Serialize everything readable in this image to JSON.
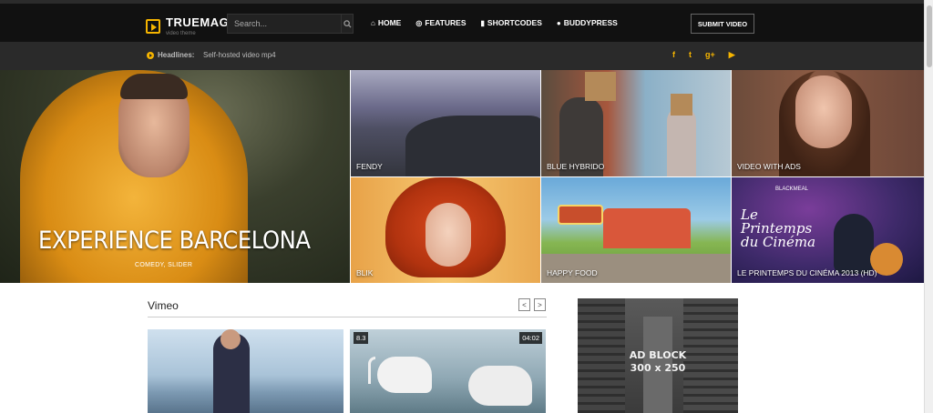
{
  "header": {
    "logo": {
      "name": "TRUEMAG",
      "tagline": "video theme"
    },
    "search": {
      "placeholder": "Search..."
    },
    "nav": [
      {
        "label": "HOME",
        "icon": "home-icon",
        "glyph": "⌂"
      },
      {
        "label": "FEATURES",
        "icon": "target-icon",
        "glyph": "◎"
      },
      {
        "label": "SHORTCODES",
        "icon": "bookmark-icon",
        "glyph": "▮"
      },
      {
        "label": "BUDDYPRESS",
        "icon": "user-icon",
        "glyph": "●"
      }
    ],
    "submit_label": "SUBMIT VIDEO"
  },
  "headlines": {
    "label": "Headlines:",
    "text": "Self-hosted video mp4",
    "social": [
      {
        "icon": "facebook-icon",
        "glyph": "f"
      },
      {
        "icon": "twitter-icon",
        "glyph": "t"
      },
      {
        "icon": "google-plus-icon",
        "glyph": "g+"
      },
      {
        "icon": "youtube-icon",
        "glyph": "▶"
      }
    ]
  },
  "hero": {
    "main": {
      "title": "EXPERIENCE BARCELONA",
      "category": "COMEDY, SLIDER"
    },
    "tiles": [
      {
        "caption": "FENDY"
      },
      {
        "caption": "BLUE HYBRIDO"
      },
      {
        "caption": "VIDEO WITH ADS"
      },
      {
        "caption": "BLIK"
      },
      {
        "caption": "HAPPY FOOD"
      },
      {
        "caption": "LE PRINTEMPS DU CINÉMA 2013 (HD)"
      }
    ],
    "poster_text": {
      "top": "BLACKMEAL",
      "script": "Le Printemps du Cinéma"
    }
  },
  "vimeo": {
    "title": "Vimeo",
    "prev": "<",
    "next": ">",
    "videos": [
      {
        "rating": "",
        "duration": ""
      },
      {
        "rating": "8.3",
        "duration": "04:02"
      }
    ]
  },
  "ad": {
    "line1": "AD BLOCK",
    "line2": "300 x 250"
  },
  "colors": {
    "accent": "#f5b400",
    "topbar": "#111111",
    "headline_bar": "#2a2a2a"
  }
}
